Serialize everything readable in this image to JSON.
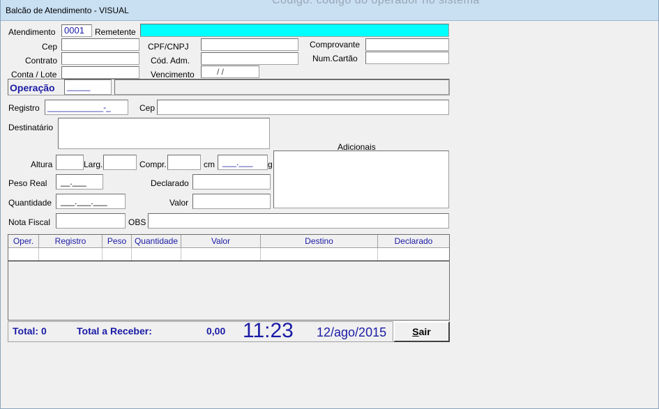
{
  "window": {
    "title": "Balcão de Atendimento - VISUAL",
    "background_title": "Código: código do operador no sistema"
  },
  "form": {
    "atendimento_label": "Atendimento",
    "atendimento_value": "0001",
    "remetente_label": "Remetente",
    "remetente_value": "",
    "cep_label": "Cep",
    "cpf_label": "CPF/CNPJ",
    "comprovante_label": "Comprovante",
    "contrato_label": "Contrato",
    "cod_adm_label": "Cód. Adm.",
    "num_cartao_label": "Num.Cartão",
    "conta_lote_label": "Conta / Lote",
    "vencimento_label": "Vencimento",
    "vencimento_mask": "/    /",
    "operacao_label": "Operação",
    "operacao_mask": "_____",
    "registro_label": "Registro",
    "registro_mask": "____________-_",
    "cep2_label": "Cep",
    "destinatario_label": "Destinatário",
    "adicionais_label": "Adicionais",
    "altura_label": "Altura",
    "larg_label": "Larg.",
    "compr_label": "Compr.",
    "cm_label": "cm",
    "peso_mask": "___.___",
    "g_label": "g",
    "peso_real_label": "Peso Real",
    "peso_real_mask": "__.___",
    "declarado_label": "Declarado",
    "quantidade_label": "Quantidade",
    "quantidade_mask": "___.___.___",
    "valor_label": "Valor",
    "nota_fiscal_label": "Nota Fiscal",
    "obs_label": "OBS"
  },
  "table": {
    "columns": [
      "Oper.",
      "Registro",
      "Peso",
      "Quantidade",
      "Valor",
      "Destino",
      "Declarado"
    ]
  },
  "status": {
    "total": "Total: 0",
    "total_receber_label": "Total a Receber:",
    "total_receber_value": "0,00",
    "clock": "11:23",
    "date": "12/ago/2015"
  },
  "buttons": {
    "sair_underlined": "S",
    "sair_rest": "air"
  },
  "colors": {
    "accent_blue": "#1a1aa6",
    "remetente_bg": "#00ffff"
  }
}
